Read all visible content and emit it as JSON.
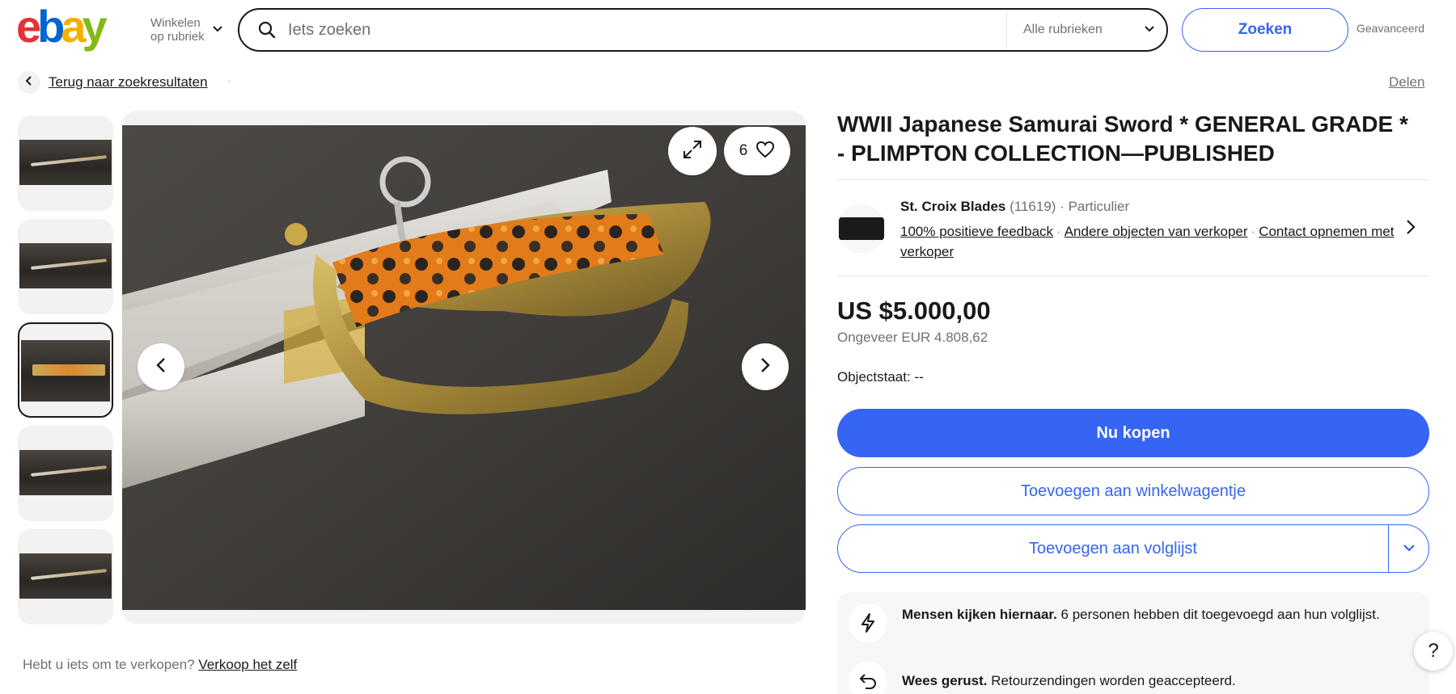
{
  "header": {
    "logo_letters": [
      "e",
      "b",
      "a",
      "y"
    ],
    "category_menu": "Winkelen op rubriek",
    "search_placeholder": "Iets zoeken",
    "search_category": "Alle rubrieken",
    "search_button": "Zoeken",
    "advanced": "Geavanceerd"
  },
  "breadcrumb": {
    "back_label": "Terug naar zoekresultaten",
    "separator": "·",
    "share": "Delen"
  },
  "gallery": {
    "thumbnail_count": 5,
    "selected_index": 2,
    "watch_count": "6"
  },
  "sell": {
    "prompt": "Hebt u iets om te verkopen?",
    "link": "Verkoop het zelf"
  },
  "listing": {
    "title": "WWII Japanese Samurai Sword * GENERAL GRADE * - PLIMPTON COLLECTION—PUBLISHED",
    "seller_name": "St. Croix Blades",
    "seller_score": "(11619)",
    "seller_type": "· Particulier",
    "feedback": "100% positieve feedback",
    "other_items": "Andere objecten van verkoper",
    "contact": "Contact opnemen met verkoper",
    "link_separator": "·",
    "price": "US $5.000,00",
    "price_approx_label": "Ongeveer",
    "price_approx_value": "EUR 4.808,62",
    "condition_label": "Objectstaat:",
    "condition_value": "--",
    "buy_now": "Nu kopen",
    "add_to_cart": "Toevoegen aan winkelwagentje",
    "add_to_watchlist": "Toevoegen aan volglijst"
  },
  "info": {
    "watching_bold": "Mensen kijken hiernaar.",
    "watching_text": "6 personen hebben dit toegevoegd aan hun volglijst.",
    "returns_bold": "Wees gerust.",
    "returns_text": "Retourzendingen worden geaccepteerd."
  },
  "help": "?",
  "colors": {
    "ebay_red": "#e53238",
    "ebay_blue": "#0064d2",
    "ebay_yellow": "#f5af02",
    "ebay_green": "#86b817",
    "primary": "#3665f3",
    "text": "#191919",
    "muted": "#707070"
  }
}
